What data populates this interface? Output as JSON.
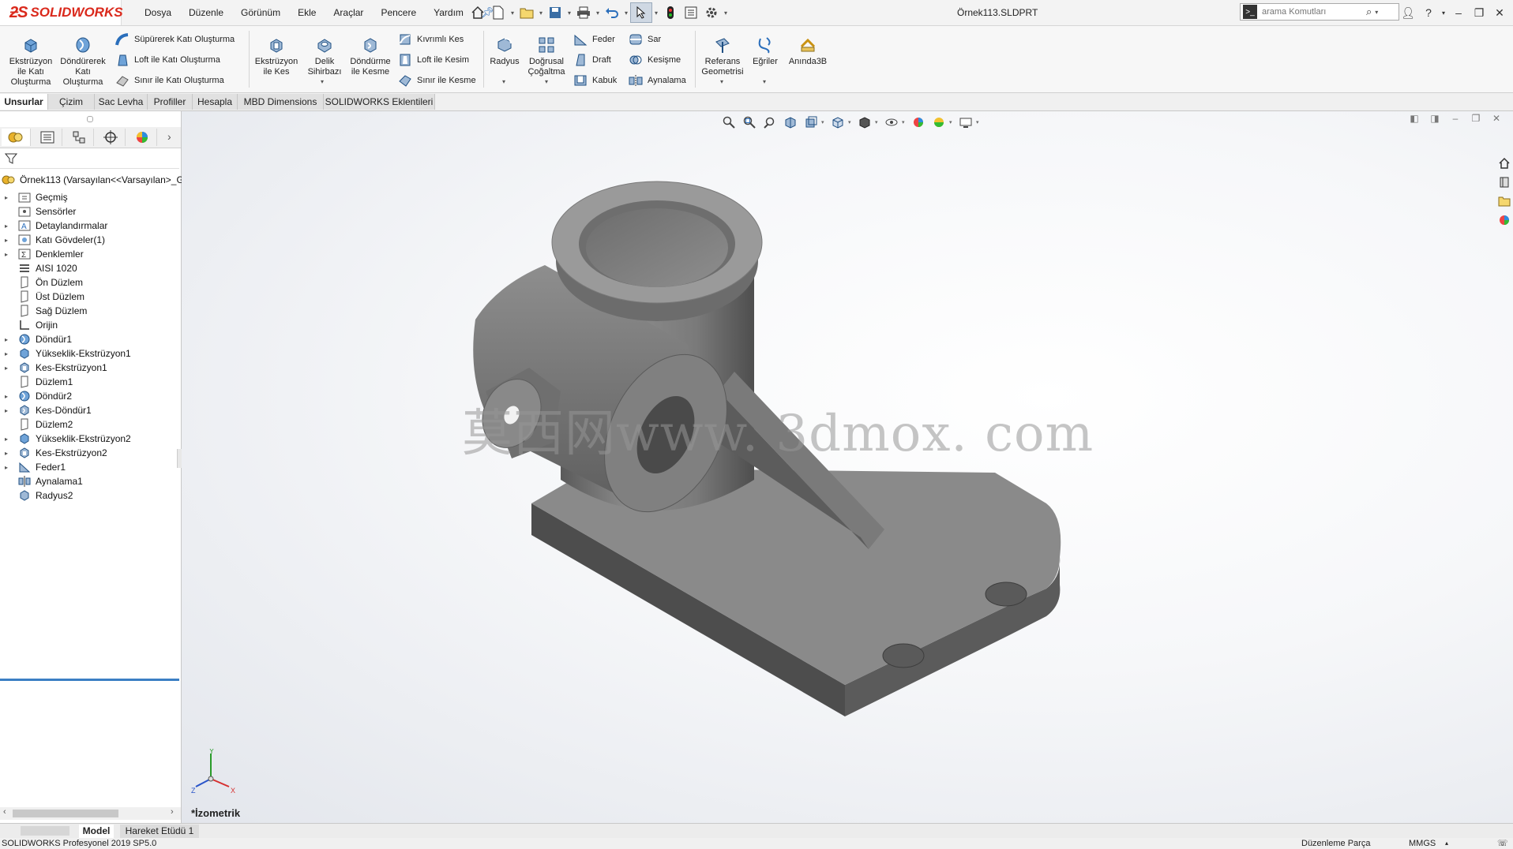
{
  "app": {
    "brand": "SOLIDWORKS",
    "document_title": "Örnek113.SLDPRT"
  },
  "menu": [
    "Dosya",
    "Düzenle",
    "Görünüm",
    "Ekle",
    "Araçlar",
    "Pencere",
    "Yardım"
  ],
  "search": {
    "placeholder": "arama Komutları"
  },
  "ribbon": {
    "extrude_boss": "Ekstrüzyon ile Katı Oluşturma",
    "revolve_boss": "Döndürerek Katı Oluşturma",
    "swept_boss": "Süpürerek Katı Oluşturma",
    "loft_boss": "Loft ile Katı Oluşturma",
    "boundary_boss": "Sınır ile Katı Oluşturma",
    "extrude_cut": "Ekstrüzyon ile Kes",
    "hole_wizard": "Delik Sihirbazı",
    "revolve_cut": "Döndürme ile Kesme",
    "swept_cut": "Kıvrımlı Kes",
    "loft_cut": "Loft ile Kesim",
    "boundary_cut": "Sınır ile Kesme",
    "fillet": "Radyus",
    "linear_pattern": "Doğrusal Çoğaltma",
    "rib": "Feder",
    "draft": "Draft",
    "shell": "Kabuk",
    "wrap": "Sar",
    "intersect": "Kesişme",
    "mirror": "Aynalama",
    "ref_geometry": "Referans Geometrisi",
    "curves": "Eğriler",
    "instant3d": "Anında3B"
  },
  "command_tabs": [
    "Unsurlar",
    "Çizim",
    "Sac Levha",
    "Profiller",
    "Hesapla",
    "MBD Dimensions",
    "SOLIDWORKS Eklentileri"
  ],
  "feature_tree": {
    "root": "Örnek113  (Varsayılan<<Varsayılan>_G",
    "items": [
      {
        "label": "Geçmiş",
        "expandable": true,
        "icon": "history-folder-icon"
      },
      {
        "label": "Sensörler",
        "expandable": false,
        "icon": "sensors-icon"
      },
      {
        "label": "Detaylandırmalar",
        "expandable": true,
        "icon": "annotations-icon"
      },
      {
        "label": "Katı Gövdeler(1)",
        "expandable": true,
        "icon": "solid-bodies-icon"
      },
      {
        "label": "Denklemler",
        "expandable": true,
        "icon": "equations-icon"
      },
      {
        "label": "AISI 1020",
        "expandable": false,
        "icon": "material-icon"
      },
      {
        "label": "Ön Düzlem",
        "expandable": false,
        "icon": "plane-icon"
      },
      {
        "label": "Üst Düzlem",
        "expandable": false,
        "icon": "plane-icon"
      },
      {
        "label": "Sağ Düzlem",
        "expandable": false,
        "icon": "plane-icon"
      },
      {
        "label": "Orijin",
        "expandable": false,
        "icon": "origin-icon"
      },
      {
        "label": "Döndür1",
        "expandable": true,
        "icon": "revolve-icon"
      },
      {
        "label": "Yükseklik-Ekstrüzyon1",
        "expandable": true,
        "icon": "extrude-icon"
      },
      {
        "label": "Kes-Ekstrüzyon1",
        "expandable": true,
        "icon": "cut-extrude-icon"
      },
      {
        "label": "Düzlem1",
        "expandable": false,
        "icon": "plane-icon"
      },
      {
        "label": "Döndür2",
        "expandable": true,
        "icon": "revolve-icon"
      },
      {
        "label": "Kes-Döndür1",
        "expandable": true,
        "icon": "cut-revolve-icon"
      },
      {
        "label": "Düzlem2",
        "expandable": false,
        "icon": "plane-icon"
      },
      {
        "label": "Yükseklik-Ekstrüzyon2",
        "expandable": true,
        "icon": "extrude-icon"
      },
      {
        "label": "Kes-Ekstrüzyon2",
        "expandable": true,
        "icon": "cut-extrude-icon"
      },
      {
        "label": "Feder1",
        "expandable": true,
        "icon": "rib-icon"
      },
      {
        "label": "Aynalama1",
        "expandable": false,
        "icon": "mirror-icon"
      },
      {
        "label": "Radyus2",
        "expandable": false,
        "icon": "fillet-icon"
      }
    ]
  },
  "viewport": {
    "watermark": "莫西网www. 3dmox. com",
    "view_name": "*İzometrik",
    "triad": {
      "x": "X",
      "y": "Y",
      "z": "Z"
    }
  },
  "bottom_tabs": [
    "Model",
    "Hareket Etüdü 1"
  ],
  "status": {
    "product": "SOLIDWORKS Profesyonel 2019 SP5.0",
    "mode": "Düzenleme Parça",
    "units": "MMGS"
  },
  "colors": {
    "accent": "#3b7fc4",
    "brand": "#da291c",
    "part": "#8a8a8a"
  }
}
